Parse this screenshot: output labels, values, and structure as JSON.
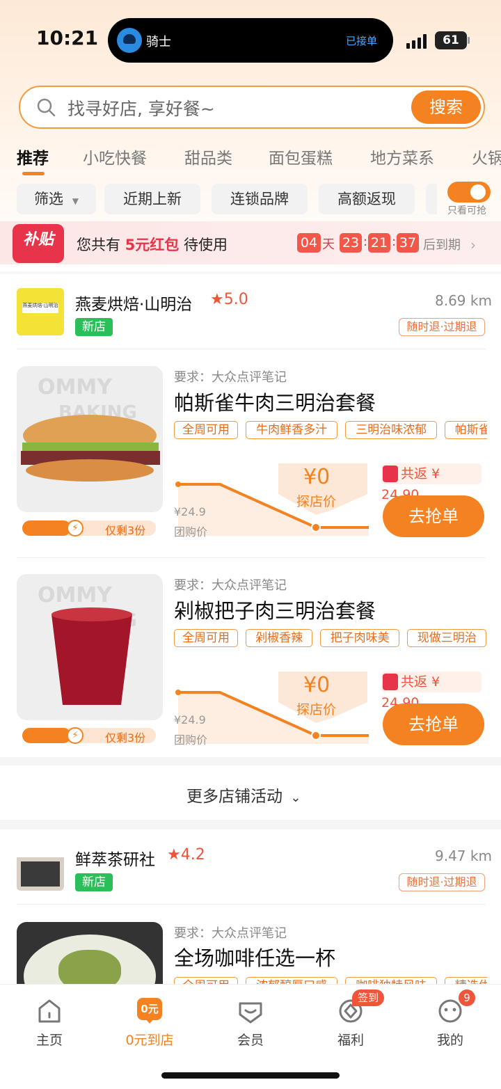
{
  "status": {
    "time": "10:21",
    "battery": "61",
    "island_title": "骑士",
    "island_status": "已接单"
  },
  "search": {
    "placeholder": "找寻好店, 享好餐~",
    "button": "搜索"
  },
  "categories": [
    "推荐",
    "小吃快餐",
    "甜品类",
    "面包蛋糕",
    "地方菜系",
    "火锅"
  ],
  "filters": {
    "filter": "筛选",
    "chips": [
      "近期上新",
      "连锁品牌",
      "高额返现"
    ],
    "toggle_label": "只看可抢"
  },
  "promo": {
    "badge": "补贴",
    "text_pre": "您共有",
    "text_red": "5元红包",
    "text_post": "待使用",
    "countdown": {
      "days": "04",
      "day_unit": "天",
      "h": "23",
      "m": "21",
      "s": "37",
      "suffix": "后到期"
    }
  },
  "stores": [
    {
      "name": "燕麦烘焙·山明治",
      "rating": "★5.0",
      "distance": "8.69 km",
      "badge": "新店",
      "policy": "随时退·过期退",
      "logo_text": "燕麦烘焙·山明治",
      "products": [
        {
          "req": "要求：大众点评笔记",
          "title": "帕斯雀牛肉三明治套餐",
          "tags": [
            "全周可用",
            "牛肉鲜香多汁",
            "三明治味浓郁",
            "帕斯雀"
          ],
          "stock": "仅剩3份",
          "old_price": "¥24.9",
          "old_label": "团购价",
          "tan_price": "¥0",
          "tan_label": "探店价",
          "fanli": "共返 ¥ 24.90",
          "button": "去抢单"
        },
        {
          "req": "要求：大众点评笔记",
          "title": "剁椒把子肉三明治套餐",
          "tags": [
            "全周可用",
            "剁椒香辣",
            "把子肉味美",
            "现做三明治"
          ],
          "stock": "仅剩3份",
          "old_price": "¥24.9",
          "old_label": "团购价",
          "tan_price": "¥0",
          "tan_label": "探店价",
          "fanli": "共返 ¥ 24.90",
          "button": "去抢单"
        }
      ]
    },
    {
      "name": "鲜萃茶研社",
      "rating": "★4.2",
      "distance": "9.47 km",
      "badge": "新店",
      "policy": "随时退·过期退",
      "products": [
        {
          "req": "要求：大众点评笔记",
          "title": "全场咖啡任选一杯",
          "tags": [
            "全周可用",
            "浓郁醇厚口感",
            "咖啡独特风味",
            "精选优"
          ]
        }
      ]
    }
  ],
  "more_activities": "更多店铺活动",
  "tabbar": {
    "items": [
      {
        "label": "主页",
        "icon": "home-icon"
      },
      {
        "label": "0元到店",
        "icon": "zero-store-icon",
        "icon_text": "0元"
      },
      {
        "label": "会员",
        "icon": "member-icon"
      },
      {
        "label": "福利",
        "icon": "welfare-icon",
        "badge": "签到"
      },
      {
        "label": "我的",
        "icon": "profile-icon",
        "badge": "9"
      }
    ]
  },
  "colors": {
    "accent": "#f58220",
    "red": "#e8344a",
    "green": "#2bbf5a"
  }
}
